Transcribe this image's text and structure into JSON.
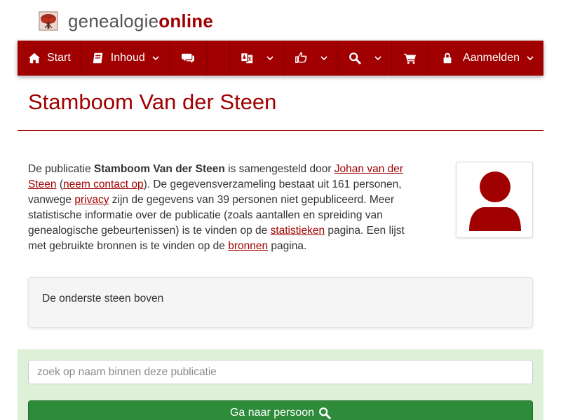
{
  "brand": {
    "name_regular": "genealogie",
    "name_bold": "online",
    "logo_icon": "tree-logo-icon"
  },
  "colors": {
    "brand_red": "#a00000",
    "success_bg": "#dff0d8",
    "success_button": "#2e8b3a"
  },
  "nav": {
    "start_label": "Start",
    "inhoud_label": "Inhoud",
    "chat_icon": "comments-icon",
    "language_icon": "translate-icon",
    "share_icon": "hand-point-icon",
    "search_icon": "search-icon",
    "cart_icon": "cart-icon",
    "login_label": "Aanmelden"
  },
  "page": {
    "title": "Stamboom Van der Steen"
  },
  "description": {
    "p1": "De publicatie ",
    "publication": "Stamboom Van der Steen",
    "p2": " is samengesteld door ",
    "author_link": "Johan van der Steen",
    "p3": " (",
    "contact_link": "neem contact op",
    "p4": "). De gegevensverzameling bestaat uit 161 personen, vanwege ",
    "privacy_link": "privacy",
    "p5": " zijn de gegevens van 39 personen niet gepubliceerd. Meer statistische informatie over de publicatie (zoals aantallen en spreiding van genealogische gebeurtenissen) is te vinden op de ",
    "stats_link": "statistieken",
    "p6": " pagina. Een lijst met gebruikte bronnen is te vinden op de ",
    "sources_link": "bronnen",
    "p7": " pagina."
  },
  "well": {
    "text": "De onderste steen boven"
  },
  "search": {
    "placeholder": "zoek op naam binnen deze publicatie",
    "button_label": "Ga naar persoon"
  }
}
